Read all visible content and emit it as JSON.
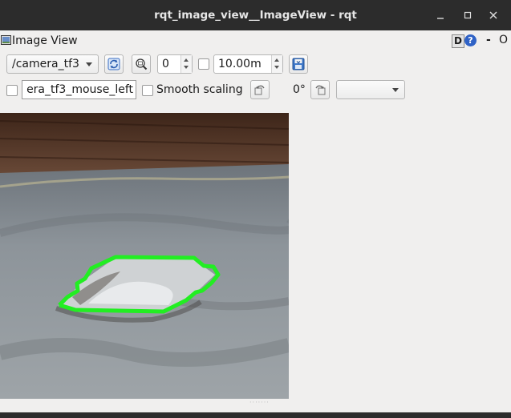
{
  "window": {
    "title": "rqt_image_view__ImageView - rqt"
  },
  "panel": {
    "title": "Image View",
    "d_label": "D",
    "help_label": "?",
    "dash_label": "-",
    "o_label": "O"
  },
  "toolbar": {
    "topic": "/camera_tf3",
    "number_value": "0",
    "distance_value": "10.00m",
    "mouse_topic": "era_tf3_mouse_left",
    "smooth_scaling_label": "Smooth scaling",
    "rotation": "0°",
    "empty_combo": ""
  },
  "colors": {
    "titlebar": "#2c2c2c",
    "outline": "#22ee22",
    "background": "#f0efee"
  },
  "icons": [
    "image-view-icon",
    "refresh-icon",
    "zoom-fit-icon",
    "save-icon",
    "rotate-left-icon",
    "rotate-right-icon",
    "minimize-icon",
    "maximize-icon",
    "close-icon"
  ]
}
